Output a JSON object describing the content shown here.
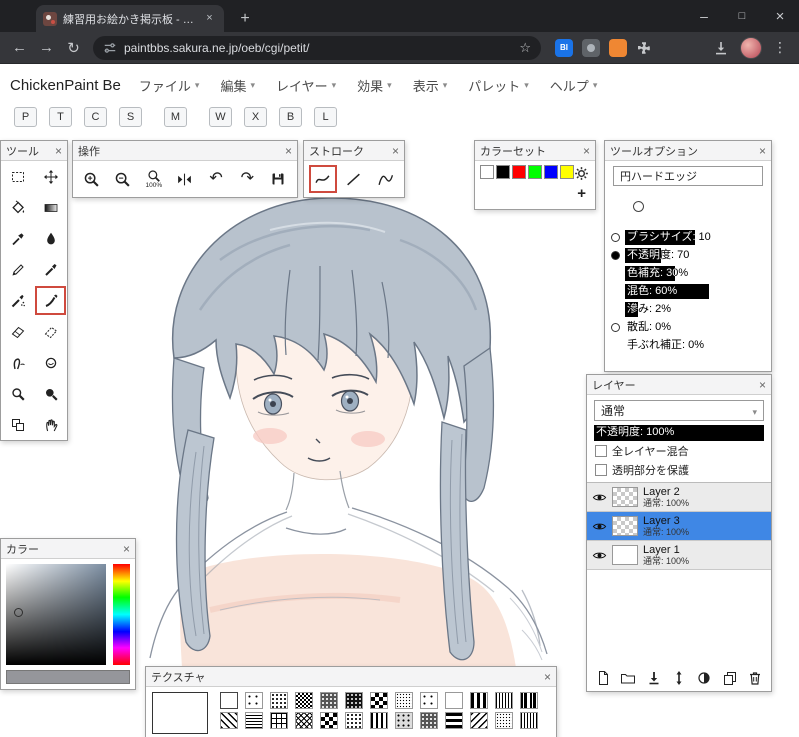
{
  "browser": {
    "tab": {
      "title": "練習用お絵かき掲示板 - お絵かき"
    },
    "url": "paintbbs.sakura.ne.jp/oeb/cgi/petit/",
    "extensions": {
      "badge1": "BI"
    }
  },
  "app": {
    "title": "ChickenPaint Be",
    "menus": [
      "ファイル",
      "編集",
      "レイヤー",
      "効果",
      "表示",
      "パレット",
      "ヘルプ"
    ],
    "shortcuts": [
      "P",
      "T",
      "C",
      "S",
      "M",
      "W",
      "X",
      "B",
      "L"
    ]
  },
  "palettes": {
    "tool": {
      "title": "ツール",
      "tools": [
        "rect-select",
        "move",
        "flood-fill",
        "gradient",
        "color-picker",
        "water",
        "pencil",
        "pen",
        "airbrush",
        "brush",
        "eraser",
        "soft-eraser",
        "smudge",
        "blender",
        "dodge",
        "burn",
        "transform",
        "hand"
      ],
      "selected_tool": "brush"
    },
    "misc": {
      "title": "操作",
      "zoom_100_label": "100%"
    },
    "stroke": {
      "title": "ストローク",
      "modes": [
        "freehand",
        "line",
        "bezier"
      ],
      "selected": "freehand"
    },
    "swatches": {
      "title": "カラーセット",
      "colors": [
        "#ffffff",
        "#000000",
        "#ff0000",
        "#00ff00",
        "#0000ff",
        "#ffff00"
      ]
    },
    "tool_options": {
      "title": "ツールオプション",
      "brush_type": "円ハードエッジ",
      "sliders": [
        {
          "label": "ブラシサイズ: 10",
          "fill": "50%",
          "radio": "empty"
        },
        {
          "label": "不透明度: 70",
          "fill": "26%",
          "radio": "filled"
        },
        {
          "label": "色補充: 30%",
          "fill": "36%",
          "radio": "none"
        },
        {
          "label": "混色: 60%",
          "fill": "60%",
          "radio": "none"
        },
        {
          "label": "滲み: 2%",
          "fill": "9%",
          "radio": "none"
        },
        {
          "label": "散乱: 0%",
          "fill": "0%",
          "radio": "empty"
        },
        {
          "label": "手ぶれ補正: 0%",
          "fill": "0%",
          "radio": "none"
        }
      ]
    },
    "layers": {
      "title": "レイヤー",
      "blend_mode": "通常",
      "opacity": {
        "label": "不透明度: 100%",
        "fill": "100%"
      },
      "checkboxes": [
        {
          "label": "全レイヤー混合",
          "checked": false
        },
        {
          "label": "透明部分を保護",
          "checked": false
        }
      ],
      "items": [
        {
          "name": "Layer 2",
          "info": "通常: 100%",
          "selected": false
        },
        {
          "name": "Layer 3",
          "info": "通常: 100%",
          "selected": true
        },
        {
          "name": "Layer 1",
          "info": "通常: 100%",
          "selected": false
        }
      ]
    },
    "color": {
      "title": "カラー",
      "current": "#95969b"
    },
    "texture": {
      "title": "テクスチャ",
      "patterns_row1": [
        "white",
        "dots-sparse",
        "dots-medium",
        "dither-50",
        "dots-dense",
        "dots-very-dense",
        "checker",
        "dot-grid",
        "dots-sparse-2",
        "white-2",
        "v-lines-bold",
        "v-lines-fine",
        "barcode"
      ],
      "patterns_row2": [
        "diagonal",
        "h-lines",
        "grid",
        "crosshatch",
        "checker-2",
        "dots-medium-2",
        "v-lines-medium",
        "dither-25",
        "dots-dense-2",
        "h-lines-bold",
        "diagonal-reverse",
        "dot-grid-2",
        "v-lines-fine-2"
      ]
    }
  },
  "canvas": {
    "description": "青灰色の髪を低いツインテールに結んだ少女の手描きスケッチ"
  }
}
